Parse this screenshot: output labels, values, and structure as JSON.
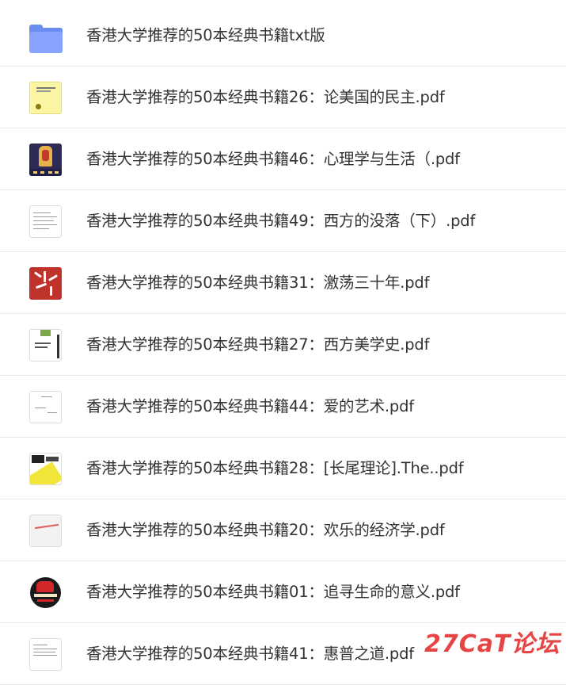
{
  "files": [
    {
      "name": "香港大学推荐的50本经典书籍txt版",
      "icon": "folder-icon",
      "kind": "folder"
    },
    {
      "name": "香港大学推荐的50本经典书籍26：论美国的民主.pdf",
      "icon": "pdf-thumbnail",
      "kind": "yellow"
    },
    {
      "name": "香港大学推荐的50本经典书籍46：心理学与生活（.pdf",
      "icon": "pdf-thumbnail",
      "kind": "dark"
    },
    {
      "name": "香港大学推荐的50本经典书籍49：西方的没落（下）.pdf",
      "icon": "pdf-thumbnail",
      "kind": "doc"
    },
    {
      "name": "香港大学推荐的50本经典书籍31：激荡三十年.pdf",
      "icon": "pdf-thumbnail",
      "kind": "red"
    },
    {
      "name": "香港大学推荐的50本经典书籍27：西方美学史.pdf",
      "icon": "pdf-thumbnail",
      "kind": "green"
    },
    {
      "name": "香港大学推荐的50本经典书籍44：爱的艺术.pdf",
      "icon": "pdf-thumbnail",
      "kind": "doc2"
    },
    {
      "name": "香港大学推荐的50本经典书籍28：[长尾理论].The..pdf",
      "icon": "pdf-thumbnail",
      "kind": "tail"
    },
    {
      "name": "香港大学推荐的50本经典书籍20：欢乐的经济学.pdf",
      "icon": "pdf-thumbnail",
      "kind": "gray"
    },
    {
      "name": "香港大学推荐的50本经典书籍01：追寻生命的意义.pdf",
      "icon": "pdf-thumbnail",
      "kind": "circle"
    },
    {
      "name": "香港大学推荐的50本经典书籍41：惠普之道.pdf",
      "icon": "pdf-thumbnail",
      "kind": "doc3"
    }
  ],
  "watermark": "27CaT论坛",
  "colors": {
    "text": "#333333",
    "divider": "#e9e9e9",
    "folder": "#86a3ff",
    "watermark": "#e43c3c"
  }
}
